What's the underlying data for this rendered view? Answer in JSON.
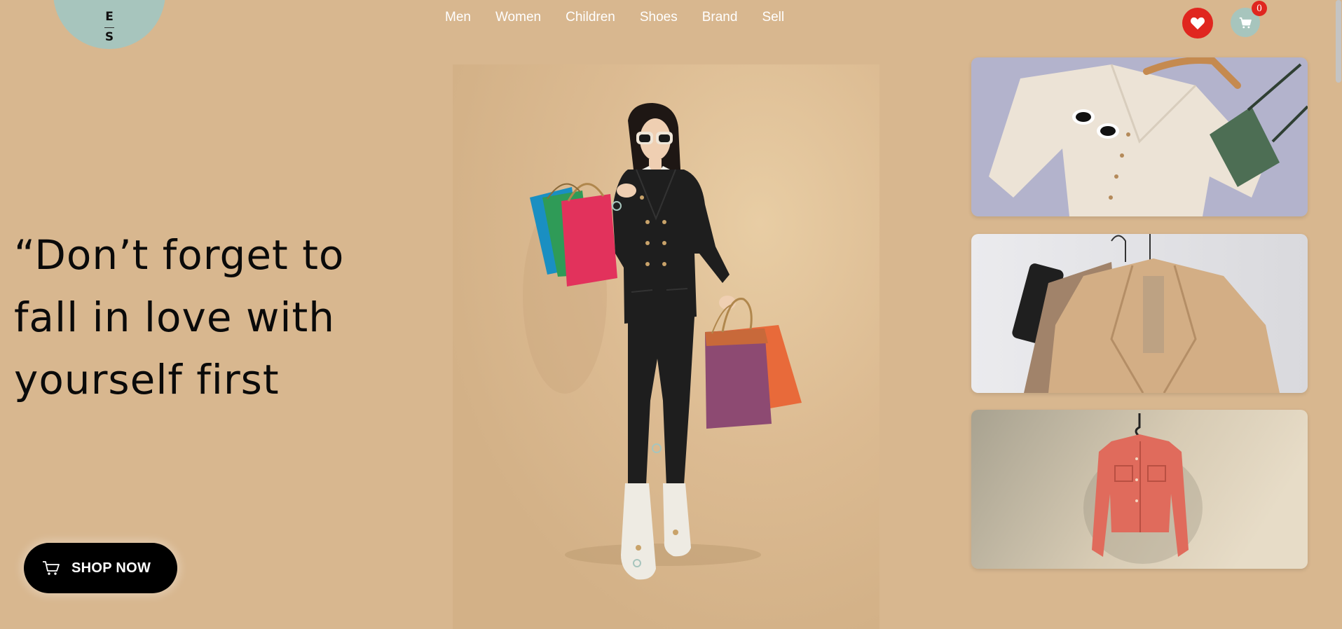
{
  "logo": {
    "letter_top": "E",
    "letter_bottom": "S"
  },
  "nav": {
    "items": [
      {
        "label": "Men"
      },
      {
        "label": "Women"
      },
      {
        "label": "Children"
      },
      {
        "label": "Shoes"
      },
      {
        "label": "Brand"
      },
      {
        "label": "Sell"
      }
    ]
  },
  "header": {
    "wishlist_icon": "heart-icon",
    "cart_icon": "cart-icon",
    "cart_count": "0"
  },
  "hero": {
    "quote_line1": "“Don’t forget to",
    "quote_line2": "fall in love with",
    "quote_line3": "yourself first",
    "shop_button_label": "SHOP NOW",
    "shop_button_icon": "cart-icon"
  },
  "colors": {
    "background": "#d8b78f",
    "accent_red": "#e0261f",
    "accent_teal": "#a7c5bd",
    "button_black": "#000000"
  }
}
